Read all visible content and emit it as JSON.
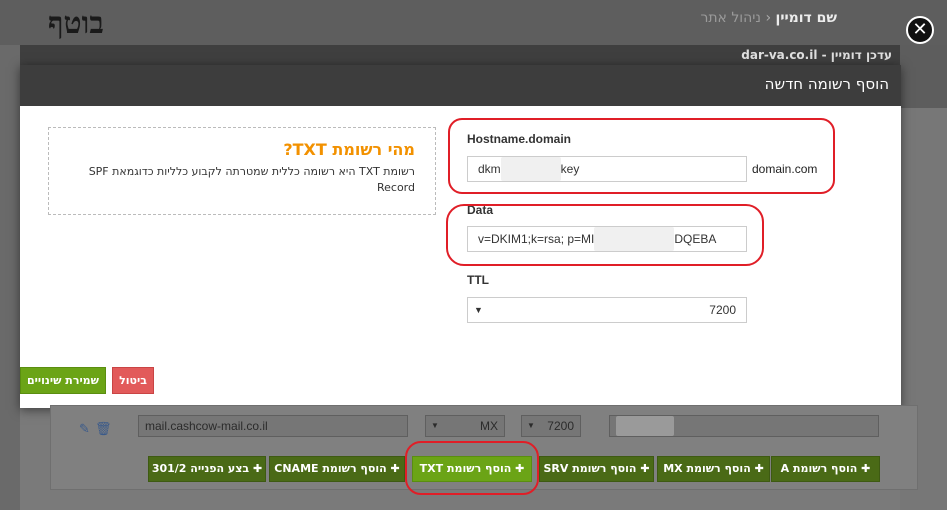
{
  "background": {
    "breadcrumb_current": "שם דומיין",
    "breadcrumb_prev": "ניהול אתר",
    "logo_text": "בוטף",
    "subheader": "עדכן דומיין - dar-va.co.il"
  },
  "modal": {
    "title": "הוסף רשומה חדשה",
    "info": {
      "title": "מהי רשומת TXT?",
      "text": "רשומת TXT היא רשומה כללית שמטרתה לקבוע כלליות כדוגמאת SPF Record"
    },
    "hostname": {
      "label": "Hostname.domain",
      "value_prefix": "dkm",
      "value_suffix": "key",
      "domain_suffix": "domain.com"
    },
    "data": {
      "label": "Data",
      "value_prefix": "v=DKIM1;k=rsa; p=MI",
      "value_suffix": "DQEBA"
    },
    "ttl": {
      "label": "TTL",
      "value": "7200"
    },
    "save_label": "שמירת שינויים",
    "cancel_label": "ביטול"
  },
  "row": {
    "host_value": "mail.cashcow-mail.co.il",
    "type_value": "MX",
    "ttl_value": "7200"
  },
  "add_buttons": [
    {
      "name": "add-a-record-button",
      "label": "הוסף רשומת A"
    },
    {
      "name": "add-mx-record-button",
      "label": "הוסף רשומת MX"
    },
    {
      "name": "add-srv-record-button",
      "label": "הוסף רשומת SRV"
    },
    {
      "name": "add-txt-record-button",
      "label": "הוסף רשומת TXT"
    },
    {
      "name": "add-cname-record-button",
      "label": "הוסף רשומת CNAME"
    },
    {
      "name": "redirect-301-button",
      "label": "בצע הפנייה 301/2"
    }
  ],
  "colors": {
    "accent_green": "#6ba416",
    "cancel_red": "#e25a5a",
    "info_orange": "#f29100",
    "highlight_red": "#e01e27"
  }
}
